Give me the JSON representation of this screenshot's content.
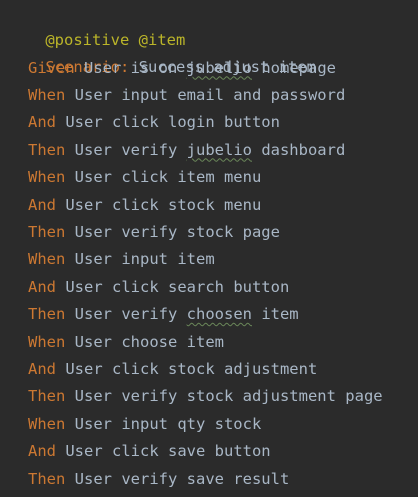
{
  "colors": {
    "background": "#2b2b2b",
    "tag": "#bbb529",
    "keyword": "#cc7832",
    "text": "#a9b7c6",
    "typo_underline": "#6a8759"
  },
  "tags": [
    "@positive",
    "@item"
  ],
  "scenario": {
    "keyword": "Scenario:",
    "title": "Success adjust item"
  },
  "steps": [
    {
      "keyword": "Given",
      "pre": "User is on ",
      "typo": "jubelio",
      "post": " homepage"
    },
    {
      "keyword": "When",
      "pre": "User input email and password",
      "typo": "",
      "post": ""
    },
    {
      "keyword": "And",
      "pre": "User click login button",
      "typo": "",
      "post": ""
    },
    {
      "keyword": "Then",
      "pre": "User verify ",
      "typo": "jubelio",
      "post": " dashboard"
    },
    {
      "keyword": "When",
      "pre": "User click item menu",
      "typo": "",
      "post": ""
    },
    {
      "keyword": "And",
      "pre": "User click stock menu",
      "typo": "",
      "post": ""
    },
    {
      "keyword": "Then",
      "pre": "User verify stock page",
      "typo": "",
      "post": ""
    },
    {
      "keyword": "When",
      "pre": "User input item",
      "typo": "",
      "post": ""
    },
    {
      "keyword": "And",
      "pre": "User click search button",
      "typo": "",
      "post": ""
    },
    {
      "keyword": "Then",
      "pre": "User verify ",
      "typo": "choosen",
      "post": " item"
    },
    {
      "keyword": "When",
      "pre": "User choose item",
      "typo": "",
      "post": ""
    },
    {
      "keyword": "And",
      "pre": "User click stock adjustment",
      "typo": "",
      "post": ""
    },
    {
      "keyword": "Then",
      "pre": "User verify stock adjustment page",
      "typo": "",
      "post": ""
    },
    {
      "keyword": "When",
      "pre": "User input qty stock",
      "typo": "",
      "post": ""
    },
    {
      "keyword": "And",
      "pre": "User click save button",
      "typo": "",
      "post": ""
    },
    {
      "keyword": "Then",
      "pre": "User verify save result",
      "typo": "",
      "post": ""
    }
  ]
}
